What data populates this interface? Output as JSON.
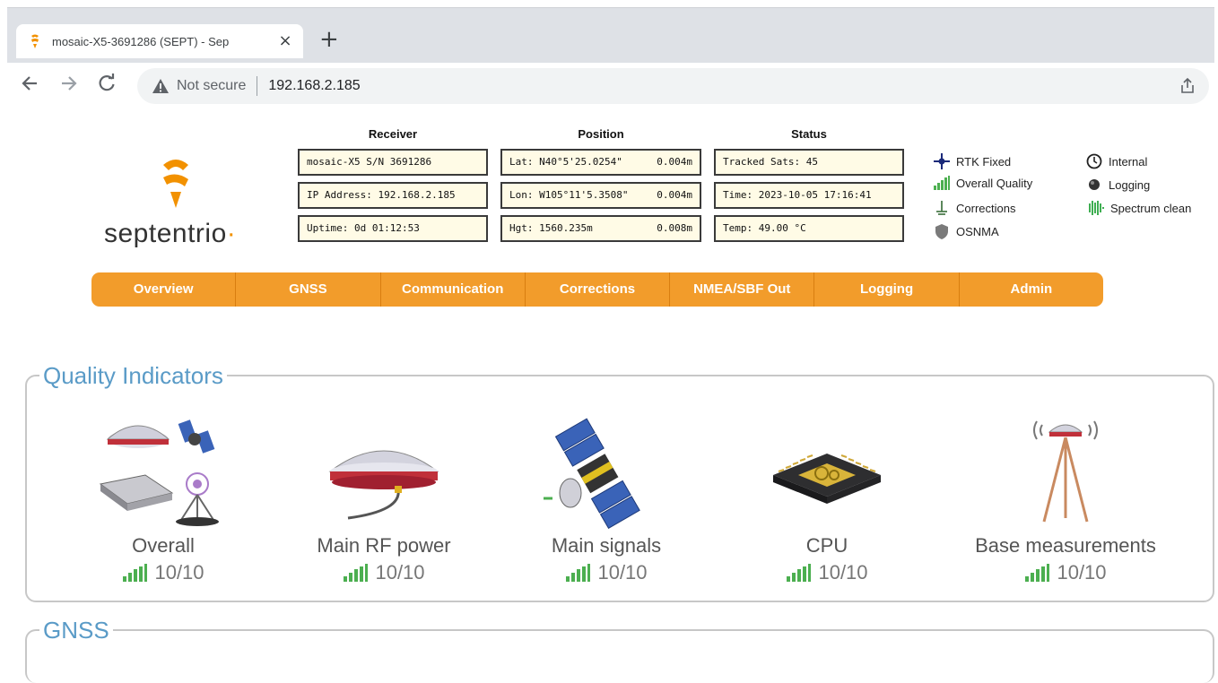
{
  "browser": {
    "tab_title": "mosaic-X5-3691286 (SEPT) - Sep",
    "close_label": "×",
    "newtab_label": "+",
    "security_label": "Not secure",
    "url": "192.168.2.185"
  },
  "brand": {
    "logo_text": "septentrio",
    "accent": "#f29100"
  },
  "receiver": {
    "heading": "Receiver",
    "model": "mosaic-X5 S/N 3691286",
    "ip": "IP Address: 192.168.2.185",
    "uptime": "Uptime: 0d 01:12:53"
  },
  "position": {
    "heading": "Position",
    "lat": "Lat:  N40°5'25.0254\"",
    "lat_acc": "0.004m",
    "lon": "Lon: W105°11'5.3508\"",
    "lon_acc": "0.004m",
    "hgt": "Hgt: 1560.235m",
    "hgt_acc": "0.008m"
  },
  "status": {
    "heading": "Status",
    "sats": "Tracked Sats: 45",
    "time": "Time: 2023-10-05 17:16:41",
    "temp": "Temp: 49.00 °C"
  },
  "legend": {
    "rtk": "RTK Fixed",
    "quality": "Overall Quality",
    "corrections": "Corrections",
    "osnma": "OSNMA",
    "internal": "Internal",
    "logging": "Logging",
    "spectrum": "Spectrum clean"
  },
  "menu": [
    "Overview",
    "GNSS",
    "Communication",
    "Corrections",
    "NMEA/SBF Out",
    "Logging",
    "Admin"
  ],
  "quality_indicators": {
    "title": "Quality Indicators",
    "items": [
      {
        "name": "Overall",
        "score": "10/10"
      },
      {
        "name": "Main RF power",
        "score": "10/10"
      },
      {
        "name": "Main signals",
        "score": "10/10"
      },
      {
        "name": "CPU",
        "score": "10/10"
      },
      {
        "name": "Base measurements",
        "score": "10/10"
      }
    ]
  },
  "gnss_section": {
    "title": "GNSS"
  },
  "colors": {
    "menu_bg": "#f29c2b",
    "legend_title": "#5a9bc7",
    "signal_green": "#4caf50"
  }
}
